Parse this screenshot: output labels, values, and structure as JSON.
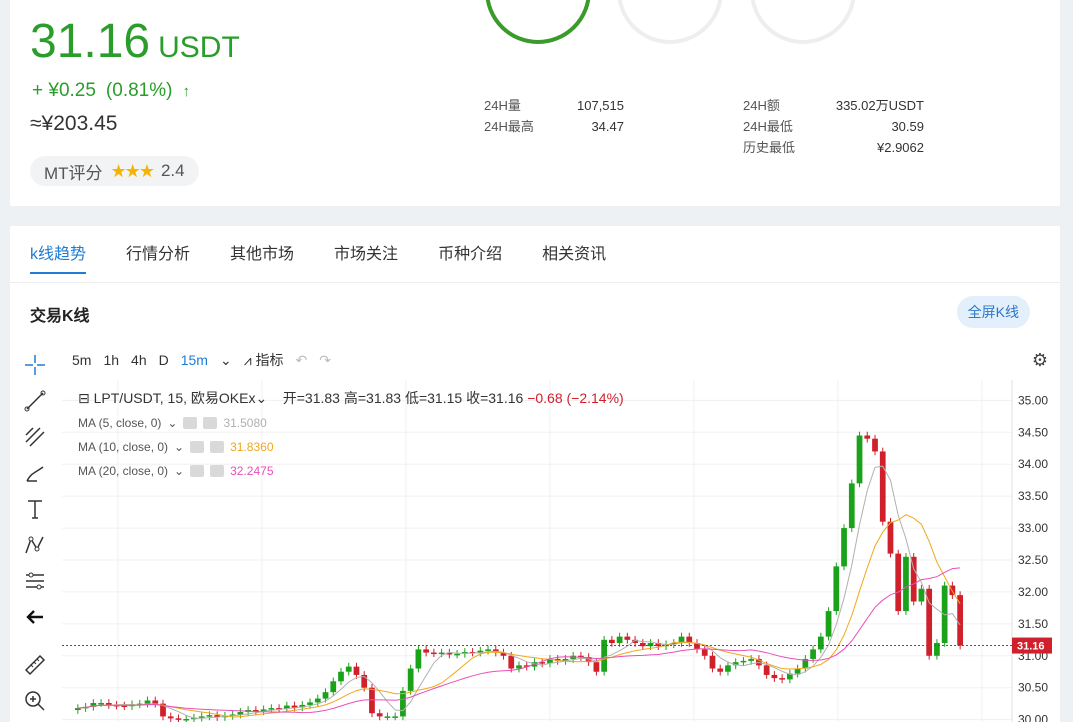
{
  "price": {
    "value": "31.16",
    "unit": "USDT",
    "change": "+ ¥0.25",
    "change_pct": "(0.81%)",
    "arrow": "↑",
    "approx": "≈¥203.45"
  },
  "rating": {
    "label": "MT评分",
    "score": "2.4",
    "stars": "★★★"
  },
  "stats_left": [
    {
      "label": "24H量",
      "value": "107,515"
    },
    {
      "label": "24H最高",
      "value": "34.47"
    }
  ],
  "stats_right": [
    {
      "label": "24H额",
      "value": "335.02万USDT"
    },
    {
      "label": "24H最低",
      "value": "30.59"
    },
    {
      "label": "历史最低",
      "value": "¥2.9062"
    }
  ],
  "tabs": [
    "k线趋势",
    "行情分析",
    "其他市场",
    "市场关注",
    "币种介绍",
    "相关资讯"
  ],
  "section_title": "交易K线",
  "fullscreen_label": "全屏K线",
  "intervals": [
    "5m",
    "1h",
    "4h",
    "D",
    "15m"
  ],
  "indicator_label": "指标",
  "legend": {
    "symbol": "LPT/USDT, 15, 欧易OKEx",
    "open": "开=31.83",
    "high": "高=31.83",
    "low": "低=31.15",
    "close": "收=31.16",
    "change": "−0.68 (−2.14%)"
  },
  "ma": [
    {
      "label": "MA (5, close, 0)",
      "value": "31.5080",
      "color": "#b0b0b0"
    },
    {
      "label": "MA (10, close, 0)",
      "value": "31.8360",
      "color": "#f0a81c"
    },
    {
      "label": "MA (20, close, 0)",
      "value": "32.2475",
      "color": "#e84fb8"
    }
  ],
  "chart_data": {
    "type": "candlestick",
    "y_ticks": [
      "35.00",
      "34.50",
      "34.00",
      "33.50",
      "33.00",
      "32.50",
      "32.00",
      "31.50",
      "31.00",
      "30.50",
      "30.00"
    ],
    "ylim": [
      29.9,
      35.1
    ],
    "last_price": "31.16",
    "closes": [
      30.18,
      30.2,
      30.26,
      30.26,
      30.23,
      30.22,
      30.21,
      30.24,
      30.25,
      30.3,
      30.25,
      30.05,
      30.02,
      30.0,
      30.01,
      30.03,
      30.05,
      30.07,
      30.04,
      30.06,
      30.08,
      30.12,
      30.15,
      30.13,
      30.16,
      30.18,
      30.17,
      30.22,
      30.19,
      30.23,
      30.27,
      30.33,
      30.43,
      30.6,
      30.75,
      30.83,
      30.7,
      30.5,
      30.1,
      30.05,
      30.05,
      30.05,
      30.45,
      30.8,
      31.1,
      31.05,
      31.04,
      31.05,
      31.02,
      31.03,
      31.06,
      31.05,
      31.08,
      31.1,
      31.05,
      31.0,
      30.8,
      30.85,
      30.83,
      30.9,
      30.88,
      30.95,
      30.92,
      30.95,
      31.0,
      30.98,
      30.9,
      30.75,
      31.25,
      31.2,
      31.3,
      31.25,
      31.2,
      31.15,
      31.2,
      31.15,
      31.18,
      31.2,
      31.3,
      31.2,
      31.1,
      31.0,
      30.8,
      30.75,
      30.85,
      30.9,
      30.92,
      30.95,
      30.85,
      30.7,
      30.65,
      30.63,
      30.72,
      30.8,
      30.95,
      31.1,
      31.3,
      31.7,
      32.4,
      33.0,
      33.7,
      34.45,
      34.4,
      34.2,
      33.1,
      32.6,
      31.7,
      32.55,
      31.85,
      32.05,
      31.0,
      31.2,
      32.1,
      31.95,
      31.16
    ]
  }
}
